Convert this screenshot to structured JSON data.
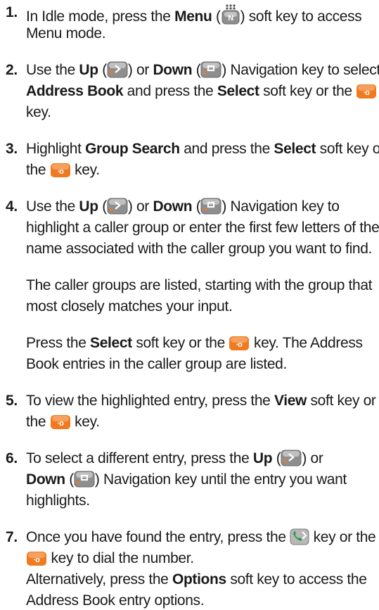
{
  "colors": {
    "text": "#1a1a1a",
    "key_gray": "#8e8e8e",
    "key_orange": "#f07a20",
    "key_green": "#2e9a4a"
  },
  "icons": {
    "menu": "menu-soft-key-icon",
    "up": "up-navigation-key-icon",
    "down": "down-navigation-key-icon",
    "select": "select-center-key-icon",
    "send": "send-call-key-icon"
  },
  "steps": [
    {
      "number": "1.",
      "lines": [
        [
          {
            "t": "In Idle mode, press the "
          },
          {
            "t": "Menu",
            "b": true
          },
          {
            "t": " ("
          },
          {
            "i": "menu"
          },
          {
            "t": ") soft key to access"
          }
        ],
        [
          {
            "t": "Menu mode."
          }
        ]
      ]
    },
    {
      "number": "2.",
      "lines": [
        [
          {
            "t": "Use the "
          },
          {
            "t": "Up",
            "b": true
          },
          {
            "t": " ("
          },
          {
            "i": "up"
          },
          {
            "t": ") or "
          },
          {
            "t": "Down",
            "b": true
          },
          {
            "t": " ("
          },
          {
            "i": "down"
          },
          {
            "t": ") Navigation key to select"
          }
        ],
        [
          {
            "t": "Address Book",
            "b": true
          },
          {
            "t": " and press the "
          },
          {
            "t": "Select",
            "b": true
          },
          {
            "t": " soft key or the "
          },
          {
            "i": "select"
          }
        ],
        [
          {
            "t": "key."
          }
        ]
      ]
    },
    {
      "number": "3.",
      "lines": [
        [
          {
            "t": "Highlight "
          },
          {
            "t": "Group Search",
            "b": true
          },
          {
            "t": " and press the "
          },
          {
            "t": "Select",
            "b": true
          },
          {
            "t": " soft key or"
          }
        ],
        [
          {
            "t": "the "
          },
          {
            "i": "select"
          },
          {
            "t": " key."
          }
        ]
      ]
    },
    {
      "number": "4.",
      "lines": [
        [
          {
            "t": "Use the "
          },
          {
            "t": "Up",
            "b": true
          },
          {
            "t": " ("
          },
          {
            "i": "up"
          },
          {
            "t": ") or "
          },
          {
            "t": "Down",
            "b": true
          },
          {
            "t": " ("
          },
          {
            "i": "down"
          },
          {
            "t": ") Navigation key to"
          }
        ],
        [
          {
            "t": "highlight a caller group or enter the first few letters of the"
          }
        ],
        [
          {
            "t": "name associated with the caller group you want to find."
          }
        ]
      ]
    },
    {
      "number": "",
      "lines": [
        [
          {
            "t": "The caller groups are listed, starting with the group that"
          }
        ],
        [
          {
            "t": "most closely matches your input."
          }
        ]
      ]
    },
    {
      "number": "",
      "lines": [
        [
          {
            "t": "Press the "
          },
          {
            "t": "Select",
            "b": true
          },
          {
            "t": " soft key or the "
          },
          {
            "i": "select"
          },
          {
            "t": " key. The Address"
          }
        ],
        [
          {
            "t": "Book entries in the caller group are listed."
          }
        ]
      ]
    },
    {
      "number": "5.",
      "lines": [
        [
          {
            "t": "To view the highlighted entry, press the "
          },
          {
            "t": "View",
            "b": true
          },
          {
            "t": " soft key or"
          }
        ],
        [
          {
            "t": "the "
          },
          {
            "i": "select"
          },
          {
            "t": " key."
          }
        ]
      ]
    },
    {
      "number": "6.",
      "lines": [
        [
          {
            "t": "To select a different entry, press the "
          },
          {
            "t": "Up",
            "b": true
          },
          {
            "t": " ("
          },
          {
            "i": "up"
          },
          {
            "t": ") or"
          }
        ],
        [
          {
            "t": "Down",
            "b": true
          },
          {
            "t": " ("
          },
          {
            "i": "down"
          },
          {
            "t": ") Navigation key until the entry you want"
          }
        ],
        [
          {
            "t": "highlights."
          }
        ]
      ]
    },
    {
      "number": "7.",
      "lines": [
        [
          {
            "t": "Once you have found the entry, press the "
          },
          {
            "i": "send"
          },
          {
            "t": " key or the"
          }
        ],
        [
          {
            "i": "select"
          },
          {
            "t": " key to dial the number."
          }
        ],
        [
          {
            "t": "Alternatively, press the "
          },
          {
            "t": "Options",
            "b": true
          },
          {
            "t": " soft key to access the"
          }
        ],
        [
          {
            "t": "Address Book entry options."
          }
        ]
      ]
    }
  ]
}
